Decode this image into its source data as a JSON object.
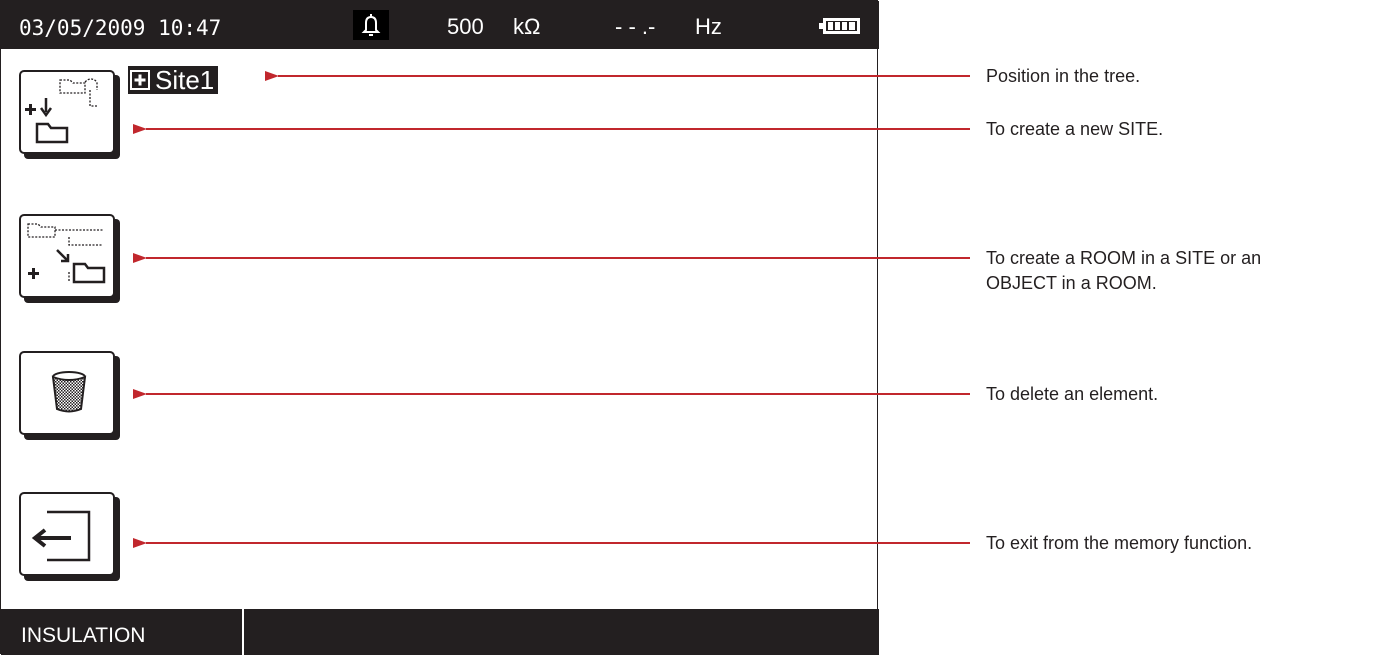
{
  "status_bar": {
    "datetime": "03/05/2009 10:47",
    "voltage_range": "500",
    "voltage_unit": "kΩ",
    "frequency_value": "- - .-",
    "frequency_unit": "Hz",
    "alarm_icon": "bell-icon",
    "battery_icon": "battery-icon"
  },
  "tree": {
    "position_label": "Site1",
    "expand_icon": "plus-box-icon"
  },
  "buttons": [
    {
      "id": "create-site",
      "icon": "create-site-icon"
    },
    {
      "id": "create-room-object",
      "icon": "create-room-object-icon"
    },
    {
      "id": "delete-element",
      "icon": "trash-icon"
    },
    {
      "id": "exit-memory",
      "icon": "exit-icon"
    }
  ],
  "function_bar": {
    "label": "INSULATION"
  },
  "annotations": {
    "tree_position": "Position in the tree.",
    "create_site": "To create a new SITE.",
    "create_room_line1": "To create a ROOM in a SITE or an",
    "create_room_line2": "OBJECT in a ROOM.",
    "delete_element": "To delete an element.",
    "exit_memory": "To exit from the memory function."
  },
  "colors": {
    "screen_dark": "#231f20",
    "arrow_red": "#c1272d",
    "background": "#ffffff"
  }
}
